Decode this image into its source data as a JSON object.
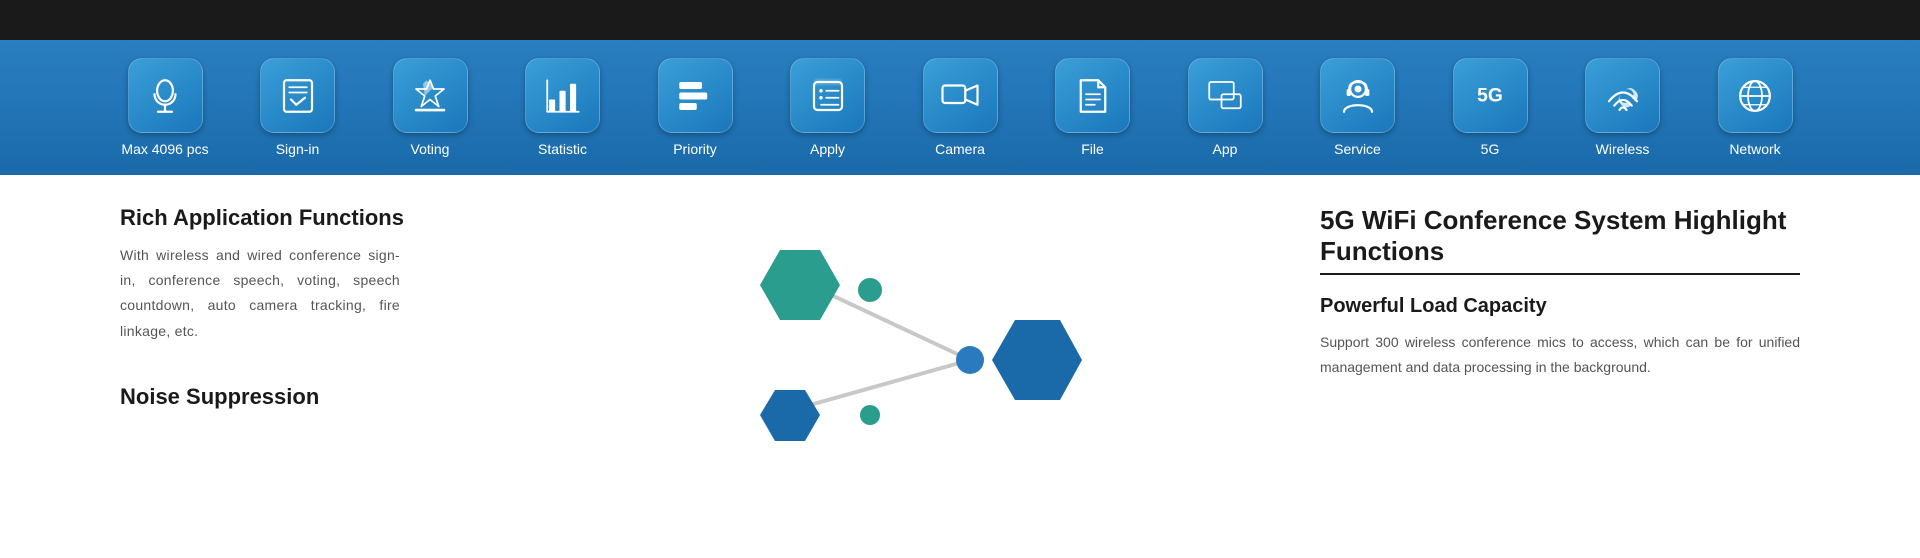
{
  "topbar": {
    "background": "#1a1a1a"
  },
  "toolbar": {
    "background_start": "#2a7fc1",
    "background_end": "#1a6aaa",
    "items": [
      {
        "id": "max4096",
        "label": "Max 4096 pcs",
        "icon": "microphone"
      },
      {
        "id": "signin",
        "label": "Sign-in",
        "icon": "signin"
      },
      {
        "id": "voting",
        "label": "Voting",
        "icon": "voting"
      },
      {
        "id": "statistic",
        "label": "Statistic",
        "icon": "statistic"
      },
      {
        "id": "priority",
        "label": "Priority",
        "icon": "priority"
      },
      {
        "id": "apply",
        "label": "Apply",
        "icon": "apply"
      },
      {
        "id": "camera",
        "label": "Camera",
        "icon": "camera"
      },
      {
        "id": "file",
        "label": "File",
        "icon": "file"
      },
      {
        "id": "app",
        "label": "App",
        "icon": "app"
      },
      {
        "id": "service",
        "label": "Service",
        "icon": "service"
      },
      {
        "id": "5g",
        "label": "5G",
        "icon": "5g"
      },
      {
        "id": "wireless",
        "label": "Wireless",
        "icon": "wireless"
      },
      {
        "id": "network",
        "label": "Network",
        "icon": "network"
      }
    ]
  },
  "content": {
    "left": {
      "rich_title": "Rich Application Functions",
      "rich_body": "With wireless and wired conference sign-in, conference speech, voting, speech countdown, auto camera tracking, fire linkage, etc.",
      "noise_title": "Noise Suppression"
    },
    "right": {
      "highlight_title": "5G WiFi Conference System  Highlight Functions",
      "capacity_title": "Powerful Load Capacity",
      "capacity_body": "Support 300 wireless conference mics to access, which can be  for unified management and data processing in the background."
    }
  }
}
